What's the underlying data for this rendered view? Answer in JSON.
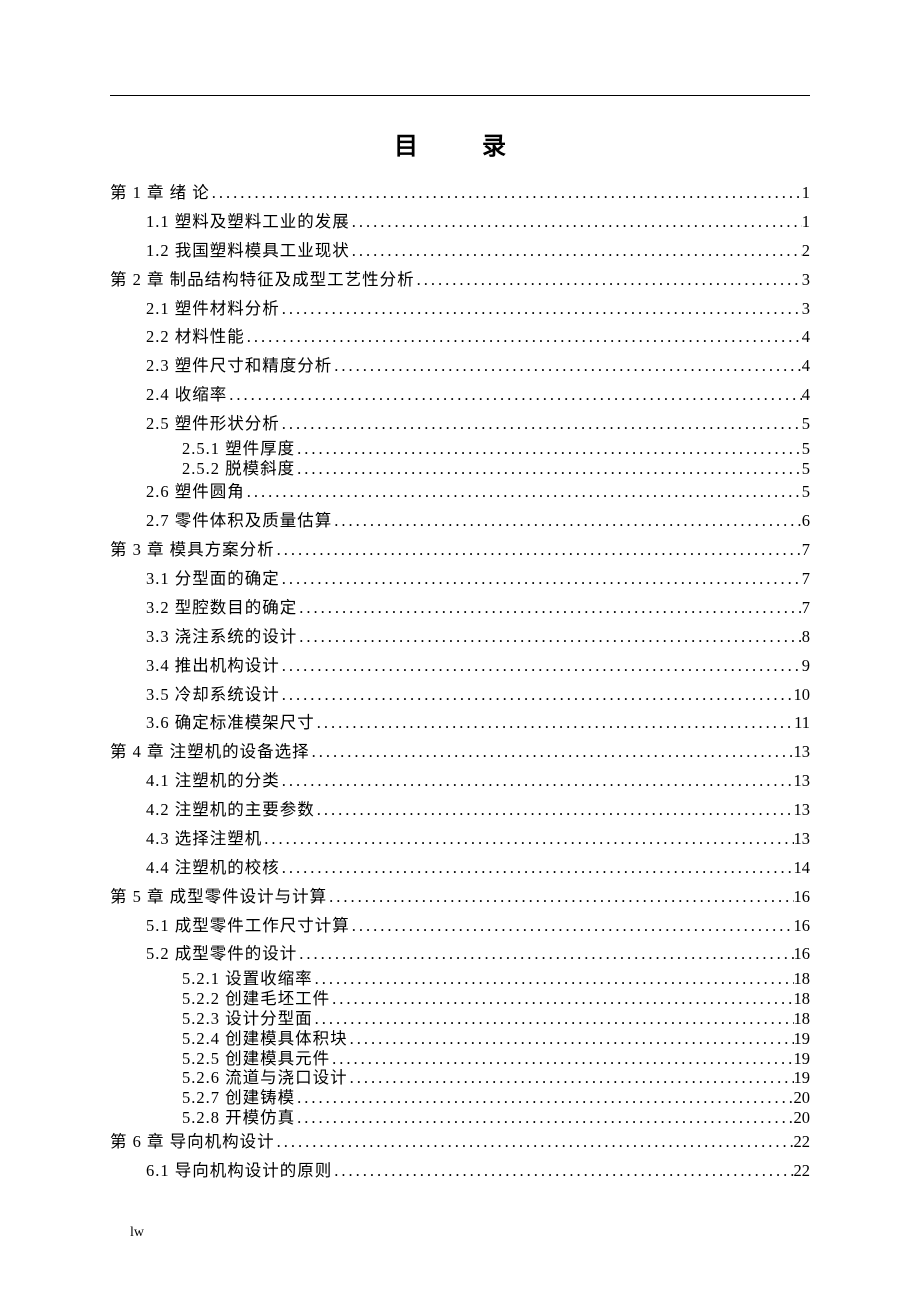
{
  "title": "目　录",
  "footer": "lw",
  "toc": [
    {
      "level": 1,
      "label": "第 1 章 绪   论",
      "page": "1"
    },
    {
      "level": 2,
      "label": "1.1 塑料及塑料工业的发展",
      "page": "1"
    },
    {
      "level": 2,
      "label": "1.2 我国塑料模具工业现状",
      "page": "2"
    },
    {
      "level": 1,
      "label": "第 2 章 制品结构特征及成型工艺性分析",
      "page": "3"
    },
    {
      "level": 2,
      "label": "2.1 塑件材料分析",
      "page": "3"
    },
    {
      "level": 2,
      "label": "2.2 材料性能",
      "page": "4"
    },
    {
      "level": 2,
      "label": "2.3 塑件尺寸和精度分析",
      "page": "4"
    },
    {
      "level": 2,
      "label": "2.4 收缩率",
      "page": "4"
    },
    {
      "level": 2,
      "label": "2.5 塑件形状分析",
      "page": "5"
    },
    {
      "level": 3,
      "label": "2.5.1 塑件厚度",
      "page": "5"
    },
    {
      "level": 3,
      "label": "2.5.2 脱模斜度",
      "page": "5"
    },
    {
      "level": 2,
      "label": "2.6 塑件圆角",
      "page": "5"
    },
    {
      "level": 2,
      "label": "2.7 零件体积及质量估算",
      "page": "6"
    },
    {
      "level": 1,
      "label": "第 3 章  模具方案分析",
      "page": "7"
    },
    {
      "level": 2,
      "label": "3.1 分型面的确定",
      "page": "7"
    },
    {
      "level": 2,
      "label": "3.2 型腔数目的确定",
      "page": "7"
    },
    {
      "level": 2,
      "label": "3.3 浇注系统的设计",
      "page": "8"
    },
    {
      "level": 2,
      "label": "3.4 推出机构设计",
      "page": "9"
    },
    {
      "level": 2,
      "label": "3.5 冷却系统设计",
      "page": "10"
    },
    {
      "level": 2,
      "label": "3.6 确定标准模架尺寸",
      "page": "11"
    },
    {
      "level": 1,
      "label": "第 4 章 注塑机的设备选择",
      "page": "13"
    },
    {
      "level": 2,
      "label": "4.1 注塑机的分类",
      "page": "13"
    },
    {
      "level": 2,
      "label": "4.2 注塑机的主要参数",
      "page": "13"
    },
    {
      "level": 2,
      "label": "4.3 选择注塑机",
      "page": "13"
    },
    {
      "level": 2,
      "label": "4.4 注塑机的校核",
      "page": "14"
    },
    {
      "level": 1,
      "label": "第 5 章 成型零件设计与计算",
      "page": "16"
    },
    {
      "level": 2,
      "label": "5.1 成型零件工作尺寸计算",
      "page": "16"
    },
    {
      "level": 2,
      "label": "5.2 成型零件的设计",
      "page": "16"
    },
    {
      "level": 3,
      "label": "5.2.1 设置收缩率",
      "page": "18"
    },
    {
      "level": 3,
      "label": "5.2.2 创建毛坯工件",
      "page": "18"
    },
    {
      "level": 3,
      "label": "5.2.3 设计分型面",
      "page": "18"
    },
    {
      "level": 3,
      "label": "5.2.4 创建模具体积块",
      "page": "19"
    },
    {
      "level": 3,
      "label": "5.2.5 创建模具元件",
      "page": "19"
    },
    {
      "level": 3,
      "label": "5.2.6 流道与浇口设计",
      "page": "19"
    },
    {
      "level": 3,
      "label": "5.2.7 创建铸模",
      "page": "20"
    },
    {
      "level": 3,
      "label": "5.2.8 开模仿真",
      "page": "20"
    },
    {
      "level": 1,
      "label": "第 6 章  导向机构设计",
      "page": "22"
    },
    {
      "level": 2,
      "label": "6.1 导向机构设计的原则",
      "page": "22"
    }
  ]
}
